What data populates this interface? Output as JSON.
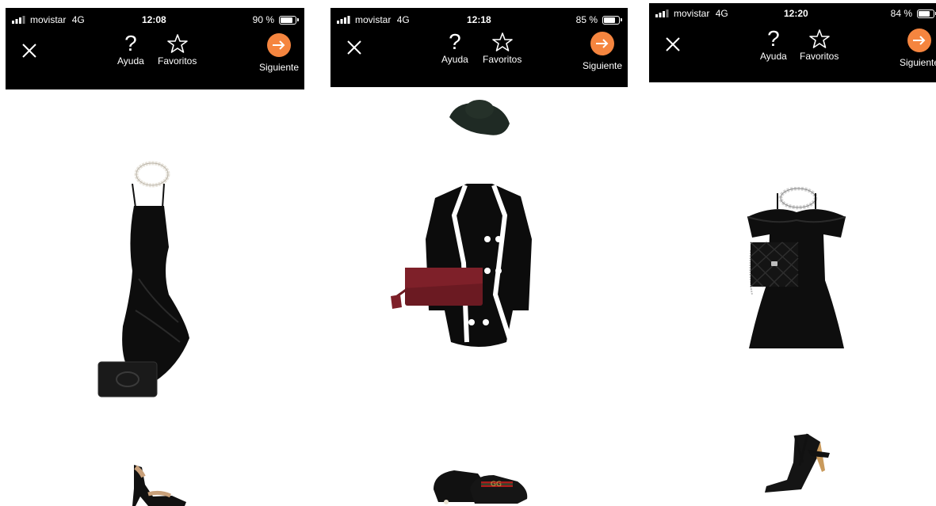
{
  "panels": [
    {
      "status": {
        "carrier": "movistar",
        "network": "4G",
        "time": "12:08",
        "battery_text": "90 %",
        "battery_level": 0.9
      },
      "toolbar": {
        "help_label": "Ayuda",
        "favorites_label": "Favoritos",
        "next_label": "Siguiente"
      },
      "items": [
        "pearl-necklace",
        "black-slip-dress",
        "black-clutch",
        "black-block-heel-sandals"
      ]
    },
    {
      "status": {
        "carrier": "movistar",
        "network": "4G",
        "time": "12:18",
        "battery_text": "85 %",
        "battery_level": 0.85
      },
      "toolbar": {
        "help_label": "Ayuda",
        "favorites_label": "Favoritos",
        "next_label": "Siguiente"
      },
      "items": [
        "dark-green-floppy-hat",
        "black-white-trim-blazer-dress",
        "burgundy-clutch-tassel",
        "gucci-loafers"
      ]
    },
    {
      "status": {
        "carrier": "movistar",
        "network": "4G",
        "time": "12:20",
        "battery_text": "84 %",
        "battery_level": 0.84
      },
      "toolbar": {
        "help_label": "Ayuda",
        "favorites_label": "Favoritos",
        "next_label": "Siguiente"
      },
      "items": [
        "crystal-necklace",
        "black-off-shoulder-dress",
        "black-quilted-bag",
        "black-strappy-sandals"
      ]
    }
  ],
  "colors": {
    "accent": "#f5853f",
    "topbar": "#000000",
    "background": "#ffffff"
  }
}
